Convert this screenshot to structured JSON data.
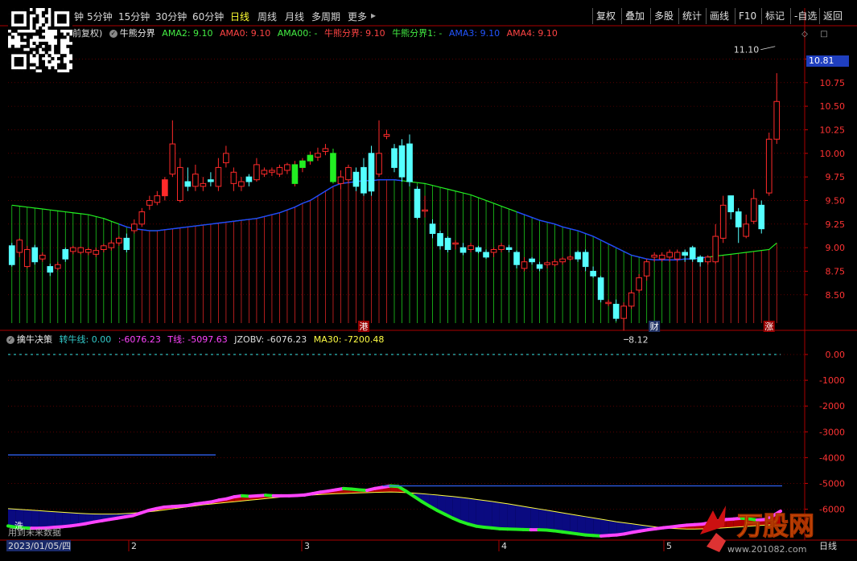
{
  "toolbar": {
    "timeframes": [
      {
        "label": "钟",
        "active": false
      },
      {
        "label": "5分钟",
        "active": false
      },
      {
        "label": "15分钟",
        "active": false
      },
      {
        "label": "30分钟",
        "active": false
      },
      {
        "label": "60分钟",
        "active": false
      },
      {
        "label": "日线",
        "active": true
      },
      {
        "label": "周线",
        "active": false
      },
      {
        "label": "月线",
        "active": false
      },
      {
        "label": "多周期",
        "active": false
      },
      {
        "label": "更多",
        "active": false
      }
    ],
    "right_buttons": [
      "复权",
      "叠加",
      "多股",
      "统计",
      "画线",
      "F10",
      "标记",
      "-自选",
      "返回"
    ]
  },
  "main_legend": {
    "prefix": "前复权)",
    "indicator_name": "牛熊分界",
    "items": [
      {
        "text": "AMA2: 9.10",
        "color": "#44ee44"
      },
      {
        "text": "AMA0: 9.10",
        "color": "#ff4444"
      },
      {
        "text": "AMA00: -",
        "color": "#44ee44"
      },
      {
        "text": "牛熊分界: 9.10",
        "color": "#ff4444"
      },
      {
        "text": "牛熊分界1: -",
        "color": "#44ee44"
      },
      {
        "text": "AMA3: 9.10",
        "color": "#2255ff"
      },
      {
        "text": "AMA4: 9.10",
        "color": "#ff4444"
      }
    ]
  },
  "sub_legend": {
    "indicator_name": "擒牛决策",
    "items": [
      {
        "text": "转牛线: 0.00",
        "color": "#33cccc"
      },
      {
        "text": ":-6076.23",
        "color": "#ff44ff"
      },
      {
        "text": "T线: -5097.63",
        "color": "#ff44ff"
      },
      {
        "text": "JZOBV: -6076.23",
        "color": "#dddddd"
      },
      {
        "text": "MA30: -7200.48",
        "color": "#ffff44"
      }
    ]
  },
  "price_axis": {
    "ticks": [
      "11.00",
      "10.75",
      "10.50",
      "10.25",
      "10.00",
      "9.75",
      "9.50",
      "9.25",
      "9.00",
      "8.75",
      "8.50"
    ],
    "current_price": "10.81",
    "high_marker": "11.10",
    "low_marker": "8.12"
  },
  "sub_axis": {
    "ticks": [
      "0.00",
      "-1000",
      "-2000",
      "-3000",
      "-4000",
      "-5000",
      "-6000"
    ]
  },
  "date_axis": {
    "start_date": "2023/01/05/四",
    "month_labels": [
      "2",
      "3",
      "4",
      "5"
    ],
    "end_label": "日线"
  },
  "annotations": {
    "gang": "港",
    "cai": "财",
    "zhang": "涨",
    "xi": "洗",
    "future_note": "用到未来数据"
  },
  "watermark": {
    "brand": "万股网",
    "url": "www.201082.com"
  },
  "colors": {
    "up": "#ff2a2a",
    "down": "#55ffff",
    "bull": "#22ee22",
    "ama3": "#2244ff",
    "ma30": "#ffff44",
    "tline": "#ff44ff",
    "grid": "#8b0000",
    "axis_text": "#ff3333"
  },
  "chart_data": {
    "type": "candlestick",
    "ylim": [
      8.2,
      11.2
    ],
    "candles": [
      [
        9.02,
        8.82,
        9.05,
        8.8
      ],
      [
        8.95,
        9.08,
        9.1,
        8.9
      ],
      [
        8.8,
        8.98,
        9.02,
        8.78
      ],
      [
        9.0,
        8.85,
        9.03,
        8.82
      ],
      [
        8.88,
        8.92,
        8.95,
        8.85
      ],
      [
        8.8,
        8.74,
        8.83,
        8.7
      ],
      [
        8.78,
        8.82,
        8.85,
        8.76
      ],
      [
        8.98,
        8.88,
        9.0,
        8.85
      ],
      [
        8.96,
        9.0,
        9.02,
        8.93
      ],
      [
        8.95,
        9.0,
        9.01,
        8.93
      ],
      [
        8.95,
        8.98,
        9.0,
        8.92
      ],
      [
        8.93,
        8.97,
        9.0,
        8.9
      ],
      [
        8.98,
        9.02,
        9.04,
        8.95
      ],
      [
        9.0,
        9.05,
        9.08,
        8.97
      ],
      [
        9.05,
        9.1,
        9.12,
        9.02
      ],
      [
        9.1,
        8.98,
        9.15,
        8.95
      ],
      [
        9.18,
        9.25,
        9.3,
        9.15
      ],
      [
        9.25,
        9.38,
        9.42,
        9.22
      ],
      [
        9.45,
        9.5,
        9.55,
        9.4
      ],
      [
        9.48,
        9.55,
        9.6,
        9.45
      ],
      [
        9.55,
        9.72,
        9.75,
        9.5
      ],
      [
        9.78,
        10.1,
        10.35,
        9.75
      ],
      [
        9.5,
        9.85,
        9.95,
        9.48
      ],
      [
        9.7,
        9.65,
        9.85,
        9.6
      ],
      [
        9.65,
        9.78,
        9.88,
        9.6
      ],
      [
        9.65,
        9.68,
        9.75,
        9.6
      ],
      [
        9.72,
        9.7,
        9.8,
        9.65
      ],
      [
        9.65,
        9.85,
        9.95,
        9.6
      ],
      [
        9.9,
        10.0,
        10.08,
        9.85
      ],
      [
        9.68,
        9.8,
        9.85,
        9.6
      ],
      [
        9.65,
        9.7,
        9.75,
        9.6
      ],
      [
        9.75,
        9.7,
        9.78,
        9.65
      ],
      [
        9.72,
        9.88,
        9.95,
        9.7
      ],
      [
        9.78,
        9.82,
        9.85,
        9.75
      ],
      [
        9.8,
        9.82,
        9.85,
        9.76
      ],
      [
        9.78,
        9.85,
        9.88,
        9.75
      ],
      [
        9.82,
        9.88,
        9.9,
        9.78
      ],
      [
        9.68,
        9.88,
        9.92,
        9.65
      ],
      [
        9.85,
        9.92,
        9.95,
        9.8
      ],
      [
        9.92,
        9.98,
        10.02,
        9.88
      ],
      [
        9.96,
        10.0,
        10.06,
        9.92
      ],
      [
        10.02,
        10.05,
        10.1,
        9.98
      ],
      [
        10.0,
        9.7,
        10.05,
        9.68
      ],
      [
        9.68,
        9.75,
        9.82,
        9.62
      ],
      [
        9.72,
        9.85,
        9.88,
        9.68
      ],
      [
        9.8,
        9.65,
        9.85,
        9.6
      ],
      [
        9.85,
        9.58,
        9.95,
        9.55
      ],
      [
        10.0,
        9.6,
        10.08,
        9.55
      ],
      [
        9.78,
        10.0,
        10.35,
        9.75
      ],
      [
        10.18,
        10.2,
        10.25,
        10.15
      ],
      [
        10.05,
        9.85,
        10.1,
        9.8
      ],
      [
        10.08,
        9.75,
        10.15,
        9.7
      ],
      [
        10.1,
        9.7,
        10.2,
        9.65
      ],
      [
        9.62,
        9.32,
        9.65,
        9.3
      ],
      [
        9.4,
        9.4,
        9.55,
        9.32
      ],
      [
        9.25,
        9.15,
        9.3,
        9.1
      ],
      [
        9.15,
        9.02,
        9.18,
        8.98
      ],
      [
        9.1,
        8.98,
        9.12,
        8.95
      ],
      [
        9.05,
        9.05,
        9.08,
        8.98
      ],
      [
        9.0,
        8.95,
        9.05,
        8.92
      ],
      [
        8.98,
        9.02,
        9.05,
        8.95
      ],
      [
        9.0,
        8.96,
        9.02,
        8.94
      ],
      [
        8.95,
        8.9,
        8.98,
        8.88
      ],
      [
        8.95,
        8.98,
        9.0,
        8.9
      ],
      [
        8.98,
        9.02,
        9.05,
        8.95
      ],
      [
        9.0,
        8.98,
        9.03,
        8.95
      ],
      [
        8.95,
        8.82,
        8.97,
        8.78
      ],
      [
        8.78,
        8.85,
        8.9,
        8.75
      ],
      [
        8.88,
        8.85,
        8.9,
        8.82
      ],
      [
        8.82,
        8.78,
        8.85,
        8.75
      ],
      [
        8.82,
        8.84,
        8.86,
        8.78
      ],
      [
        8.82,
        8.85,
        8.88,
        8.8
      ],
      [
        8.85,
        8.88,
        8.9,
        8.82
      ],
      [
        8.88,
        8.9,
        8.92,
        8.86
      ],
      [
        8.95,
        8.88,
        8.97,
        8.85
      ],
      [
        8.95,
        8.8,
        8.98,
        8.75
      ],
      [
        8.75,
        8.7,
        8.8,
        8.68
      ],
      [
        8.68,
        8.45,
        8.7,
        8.42
      ],
      [
        8.42,
        8.42,
        8.45,
        8.38
      ],
      [
        8.4,
        8.25,
        8.45,
        8.22
      ],
      [
        8.25,
        8.38,
        8.42,
        8.12
      ],
      [
        8.38,
        8.52,
        8.55,
        8.35
      ],
      [
        8.55,
        8.68,
        8.72,
        8.52
      ],
      [
        8.7,
        8.85,
        8.88,
        8.65
      ],
      [
        8.9,
        8.92,
        8.95,
        8.85
      ],
      [
        8.88,
        8.92,
        8.95,
        8.85
      ],
      [
        8.9,
        8.95,
        8.98,
        8.85
      ],
      [
        8.88,
        8.95,
        8.98,
        8.85
      ],
      [
        8.95,
        8.92,
        8.98,
        8.85
      ],
      [
        9.0,
        8.88,
        9.02,
        8.85
      ],
      [
        8.9,
        8.85,
        8.92,
        8.8
      ],
      [
        8.85,
        8.9,
        8.92,
        8.82
      ],
      [
        8.85,
        9.12,
        9.25,
        8.83
      ],
      [
        9.1,
        9.45,
        9.55,
        9.05
      ],
      [
        9.55,
        9.38,
        9.55,
        9.3
      ],
      [
        9.38,
        9.22,
        9.42,
        9.05
      ],
      [
        9.12,
        9.25,
        9.35,
        9.1
      ],
      [
        9.28,
        9.52,
        9.62,
        9.25
      ],
      [
        9.45,
        9.2,
        9.5,
        9.15
      ],
      [
        9.58,
        10.15,
        10.22,
        9.55
      ],
      [
        10.15,
        10.55,
        10.85,
        10.1
      ]
    ],
    "bull_bear_line": [
      9.45,
      9.44,
      9.43,
      9.42,
      9.41,
      9.4,
      9.39,
      9.38,
      9.37,
      9.36,
      9.35,
      9.33,
      9.31,
      9.28,
      9.25,
      9.22,
      9.2,
      9.19,
      9.18,
      9.18,
      9.19,
      9.2,
      9.21,
      9.22,
      9.23,
      9.24,
      9.25,
      9.26,
      9.27,
      9.28,
      9.29,
      9.3,
      9.31,
      9.33,
      9.35,
      9.37,
      9.4,
      9.43,
      9.47,
      9.5,
      9.55,
      9.6,
      9.65,
      9.68,
      9.69,
      9.7,
      9.71,
      9.71,
      9.72,
      9.72,
      9.72,
      9.71,
      9.7,
      9.69,
      9.68,
      9.66,
      9.64,
      9.62,
      9.6,
      9.58,
      9.56,
      9.53,
      9.5,
      9.47,
      9.44,
      9.41,
      9.38,
      9.35,
      9.32,
      9.29,
      9.27,
      9.25,
      9.22,
      9.2,
      9.18,
      9.15,
      9.12,
      9.08,
      9.04,
      9.0,
      8.96,
      8.92,
      8.9,
      8.88,
      8.87,
      8.87,
      8.87,
      8.87,
      8.88,
      8.88,
      8.89,
      8.9,
      8.91,
      8.92,
      8.93,
      8.94,
      8.95,
      8.96,
      8.97,
      8.98,
      9.05
    ],
    "sub_ylim": [
      -7200,
      500
    ],
    "jzobv": [
      -6650,
      -6700,
      -6730,
      -6740,
      -6740,
      -6730,
      -6700,
      -6680,
      -6650,
      -6610,
      -6560,
      -6500,
      -6450,
      -6400,
      -6350,
      -6300,
      -6250,
      -6150,
      -6050,
      -5980,
      -5920,
      -5900,
      -5880,
      -5860,
      -5800,
      -5760,
      -5720,
      -5650,
      -5600,
      -5520,
      -5480,
      -5500,
      -5480,
      -5460,
      -5480,
      -5480,
      -5480,
      -5470,
      -5450,
      -5400,
      -5340,
      -5300,
      -5250,
      -5200,
      -5220,
      -5250,
      -5270,
      -5200,
      -5150,
      -5100,
      -5120,
      -5300,
      -5500,
      -5700,
      -5880,
      -6050,
      -6200,
      -6350,
      -6480,
      -6580,
      -6660,
      -6700,
      -6730,
      -6760,
      -6770,
      -6780,
      -6790,
      -6800,
      -6800,
      -6810,
      -6840,
      -6880,
      -6920,
      -6960,
      -7000,
      -7020,
      -7040,
      -7020,
      -7000,
      -6960,
      -6900,
      -6850,
      -6800,
      -6760,
      -6720,
      -6690,
      -6650,
      -6620,
      -6600,
      -6580,
      -6520,
      -6460,
      -6400,
      -6380,
      -6350,
      -6380,
      -6420,
      -6400,
      -6260,
      -6076
    ],
    "ma30": [
      -5980,
      -6000,
      -6020,
      -6040,
      -6060,
      -6080,
      -6100,
      -6120,
      -6140,
      -6160,
      -6175,
      -6185,
      -6190,
      -6190,
      -6185,
      -6170,
      -6150,
      -6130,
      -6100,
      -6070,
      -6030,
      -5990,
      -5950,
      -5910,
      -5870,
      -5830,
      -5800,
      -5770,
      -5740,
      -5710,
      -5680,
      -5650,
      -5620,
      -5590,
      -5560,
      -5530,
      -5510,
      -5490,
      -5470,
      -5450,
      -5430,
      -5415,
      -5400,
      -5390,
      -5380,
      -5370,
      -5360,
      -5350,
      -5340,
      -5335,
      -5340,
      -5355,
      -5375,
      -5400,
      -5425,
      -5450,
      -5480,
      -5510,
      -5545,
      -5580,
      -5620,
      -5660,
      -5700,
      -5745,
      -5790,
      -5840,
      -5890,
      -5940,
      -5990,
      -6040,
      -6090,
      -6140,
      -6190,
      -6240,
      -6290,
      -6340,
      -6390,
      -6440,
      -6490,
      -6530,
      -6570,
      -6610,
      -6650,
      -6690,
      -6720,
      -6745,
      -6760,
      -6770,
      -6770,
      -6765,
      -6755,
      -6740,
      -6720,
      -6700,
      -6680,
      -6660,
      -6640,
      -6620,
      -6600,
      -6580
    ],
    "t_line_level": -5097.63,
    "turn_bull_level": 0.0
  }
}
